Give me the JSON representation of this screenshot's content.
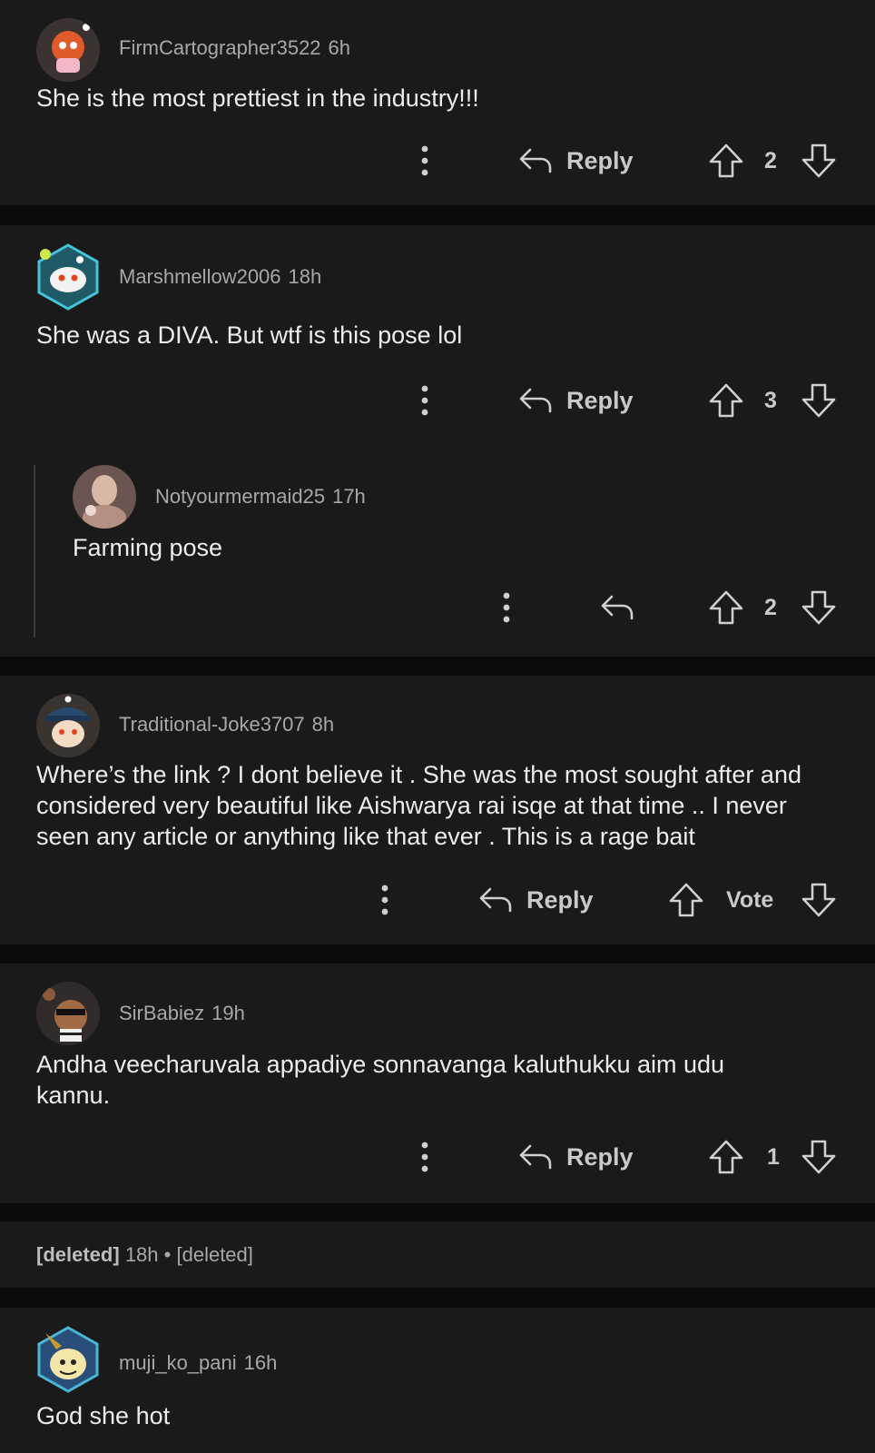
{
  "comments": [
    {
      "user": "FirmCartographer3522",
      "age": "6h",
      "text": "She is the most prettiest in the industry!!!",
      "reply_label": "Reply",
      "votes": "2"
    },
    {
      "user": "Marshmellow2006",
      "age": "18h",
      "text": "She was a DIVA. But wtf is this pose lol",
      "reply_label": "Reply",
      "votes": "3",
      "reply": {
        "user": "Notyourmermaid25",
        "age": "17h",
        "text": "Farming pose",
        "votes": "2"
      }
    },
    {
      "user": "Traditional-Joke3707",
      "age": "8h",
      "lines": [
        "Where’s the link ? I dont believe it . She was the most sought after and",
        "considered very beautiful like Aishwarya rai isqe at that time .. I never",
        "seen any article or anything like that ever . This is a rage bait"
      ],
      "reply_label": "Reply",
      "votes": "Vote"
    },
    {
      "user": "SirBabiez",
      "age": "19h",
      "lines": [
        "Andha veecharuvala appadiye sonnavanga kaluthukku aim udu",
        "kannu."
      ],
      "reply_label": "Reply",
      "votes": "1"
    },
    {
      "user": "[deleted]",
      "age": "18h",
      "separator": "•",
      "text": "[deleted]"
    },
    {
      "user": "muji_ko_pani",
      "age": "16h",
      "text": "God she hot"
    }
  ],
  "colors": {
    "background": "#0b0b0c",
    "card": "#1a1a1b",
    "username": "#a8a8ab",
    "body": "#ececec",
    "thread_line": "#3a3a3c"
  }
}
